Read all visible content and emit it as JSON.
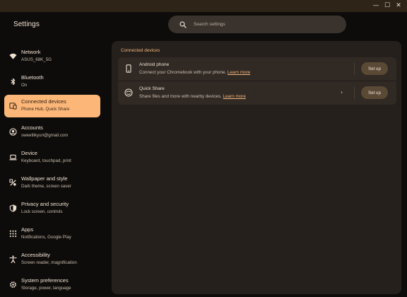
{
  "window": {
    "minimize_glyph": "—",
    "maximize_glyph": "☐",
    "close_glyph": "✕"
  },
  "app": {
    "title": "Settings"
  },
  "search": {
    "placeholder": "Search settings"
  },
  "sidebar": {
    "items": [
      {
        "title": "Network",
        "subtitle": "ASUS_68K_5G",
        "icon": "wifi-icon",
        "selected": false
      },
      {
        "title": "Bluetooth",
        "subtitle": "On",
        "icon": "bluetooth-icon",
        "selected": false
      },
      {
        "title": "Connected devices",
        "subtitle": "Phone Hub, Quick Share",
        "icon": "connected-devices-icon",
        "selected": true
      },
      {
        "title": "Accounts",
        "subtitle": "sweetlikyuri@gmail.com",
        "icon": "account-icon",
        "selected": false
      },
      {
        "title": "Device",
        "subtitle": "Keyboard, touchpad, print",
        "icon": "laptop-icon",
        "selected": false
      },
      {
        "title": "Wallpaper and style",
        "subtitle": "Dark theme, screen saver",
        "icon": "palette-icon",
        "selected": false
      },
      {
        "title": "Privacy and security",
        "subtitle": "Lock screen, controls",
        "icon": "shield-icon",
        "selected": false
      },
      {
        "title": "Apps",
        "subtitle": "Notifications, Google Play",
        "icon": "apps-grid-icon",
        "selected": false
      },
      {
        "title": "Accessibility",
        "subtitle": "Screen reader, magnification",
        "icon": "accessibility-icon",
        "selected": false
      },
      {
        "title": "System preferences",
        "subtitle": "Storage, power, language",
        "icon": "gear-icon",
        "selected": false
      }
    ]
  },
  "main": {
    "section_title": "Connected devices",
    "rows": [
      {
        "title": "Android phone",
        "subtitle": "Connect your Chromebook with your phone.",
        "link": "Learn more",
        "button": "Set up",
        "icon": "phone-icon"
      },
      {
        "title": "Quick Share",
        "subtitle": "Share files and more with nearby devices.",
        "link": "Learn more",
        "button": "Set up",
        "icon": "quick-share-icon",
        "chevron": "›"
      }
    ]
  },
  "colors": {
    "accent": "#fbb678",
    "link": "#f3b57c",
    "background": "#0e0c0a",
    "panel": "#25201c"
  }
}
